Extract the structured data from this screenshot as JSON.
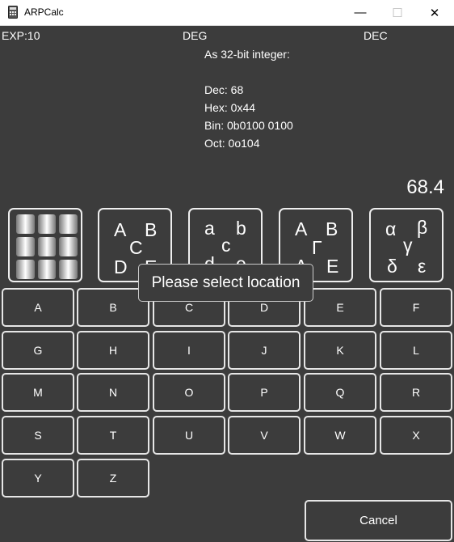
{
  "window": {
    "title": "ARPCalc",
    "minimize": "—",
    "maximize": "☐",
    "close": "✕"
  },
  "status": {
    "exp": "EXP:10",
    "angle": "DEG",
    "base": "DEC"
  },
  "info": {
    "heading": "As 32-bit integer:",
    "dec": "Dec: 68",
    "hex": "Hex: 0x44",
    "bin": "Bin: 0b0100 0100",
    "oct": "Oct: 0o104"
  },
  "display": {
    "value": "68.4"
  },
  "modes": {
    "upper": [
      "A",
      "B",
      "C",
      "D",
      "E"
    ],
    "lower": [
      "a",
      "b",
      "c",
      "d",
      "e"
    ],
    "greek_upper": [
      "Α",
      "Β",
      "Γ",
      "Δ",
      "Ε"
    ],
    "greek_lower": [
      "α",
      "β",
      "γ",
      "δ",
      "ε"
    ]
  },
  "keys": [
    "A",
    "B",
    "C",
    "D",
    "E",
    "F",
    "G",
    "H",
    "I",
    "J",
    "K",
    "L",
    "M",
    "N",
    "O",
    "P",
    "Q",
    "R",
    "S",
    "T",
    "U",
    "V",
    "W",
    "X",
    "Y",
    "Z"
  ],
  "tooltip": "Please select location",
  "cancel": "Cancel"
}
